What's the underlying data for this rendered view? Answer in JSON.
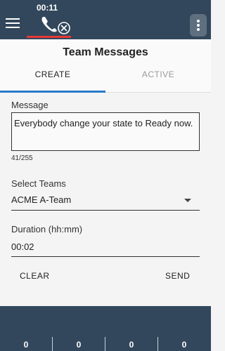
{
  "statusbar": {
    "call_timer": "00:11"
  },
  "header": {
    "title": "Team Messages",
    "tabs": [
      {
        "label": "CREATE",
        "selected": true
      },
      {
        "label": "ACTIVE",
        "selected": false
      }
    ]
  },
  "form": {
    "message": {
      "label": "Message",
      "value": "Everybody change your state to Ready now.",
      "counter": "41/255"
    },
    "teams": {
      "label": "Select Teams",
      "selected": "ACME A-Team"
    },
    "duration": {
      "label": "Duration (hh:mm)",
      "value": "00:02"
    },
    "buttons": {
      "clear": "CLEAR",
      "send": "SEND"
    }
  },
  "bottom_stats": [
    "0",
    "0",
    "0",
    "0"
  ],
  "colors": {
    "topbar": "#32475c",
    "accent": "#2979c6",
    "call_underline": "#e53935"
  },
  "icons": [
    "menu-icon",
    "phone-hangup-icon",
    "more-vert-icon",
    "dropdown-caret-icon"
  ]
}
